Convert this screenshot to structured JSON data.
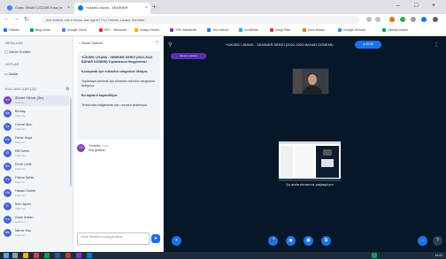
{
  "browser": {
    "tabs": [
      {
        "label": "Sınav SINAV ÇÖZÜM Kısa | ▸",
        "active": false
      },
      {
        "label": "Yüksek Lisans - SEMİNER",
        "active": true
      }
    ],
    "new_tab": "+",
    "url": "bbb.blikent.edu.tr/b/osz-nav-lgk-tr7/?c=Yüksek-Lisans-Seminer",
    "bookmarks": [
      "Fakülte",
      "Blog İçerik",
      "Google Çeviri",
      "KEY - Microsoft",
      "Dosya Görsel",
      "YÖK Akademik",
      "Yeni sekme",
      "ULAKBİM",
      "Dergi Park",
      "Ders Notları",
      "Google Scholar",
      "Okuma Listesi"
    ]
  },
  "userlist": {
    "messages_title": "MESAJLAR",
    "public_chat": "Genel Sohbet",
    "notes_title": "NOTLAR",
    "notes_item": "Notlar",
    "users_title": "KULLANICILAR (26)",
    "users": [
      {
        "initials": "Ah",
        "name": "Ahmet Yılmaz (Siz)",
        "role": "Sunucu"
      },
      {
        "initials": "Be",
        "name": "Berkay",
        "role": "Katılımcı"
      },
      {
        "initials": "Ce",
        "name": "Cemal Akın",
        "role": "Katılımcı"
      },
      {
        "initials": "De",
        "name": "Deniz Kaya",
        "role": "Katılımcı"
      },
      {
        "initials": "El",
        "name": "Elif Demir",
        "role": "Katılımcı"
      },
      {
        "initials": "Em",
        "name": "Emre Çelik",
        "role": "Katılımcı"
      },
      {
        "initials": "Fa",
        "name": "Fatma Şahin",
        "role": "Katılımcı"
      },
      {
        "initials": "Ha",
        "name": "Hakan Öztürk",
        "role": "Katılımcı"
      },
      {
        "initials": "İr",
        "name": "İrem Aydın",
        "role": "Katılımcı"
      },
      {
        "initials": "Ka",
        "name": "Kaan Arslan",
        "role": "Katılımcı"
      },
      {
        "initials": "Me",
        "name": "Merve Koç",
        "role": "Katılımcı"
      }
    ]
  },
  "chat": {
    "header": "Genel Sohbet",
    "close": "×",
    "welcome_title": "YÜKSEK LİSANS - SEMİNER DERSİ (2022-2023 BAHAR DÖNEMİ) Toplantısına Hoşgeldiniz!",
    "welcome_p1": "Konuşmak için mikrofon simgesine tıklayın.",
    "welcome_p2": "Toplantıya katılmak için ekranda mikrofon simgesine tıklayınız.",
    "welcome_p3": "Bu toplantı kaydediliyor",
    "welcome_p4": "Telefondan bağlanmak için: numara bekleniyor",
    "msg_initials": "Yö",
    "msg_name": "Yönetici",
    "msg_time": "14:02",
    "msg_text": "Hoş geldiniz.",
    "input_placeholder": "Genel Sohbet'e mesaj gönderin",
    "send": "➤"
  },
  "main": {
    "title": "YÜKSEK LİSANS - SEMİNER DERSİ (2022-2023 BAHAR DÖNEMİ)",
    "recording": "00:55",
    "tag": "Sunucu ekranı",
    "share_label": "Şu anda ekranınız paylaşılıyor",
    "controls": [
      "+",
      "🎤",
      "◉",
      "▣",
      "⧉"
    ],
    "right_controls": [
      "⋯",
      "?"
    ]
  },
  "taskbar": {
    "clock": "14:03"
  }
}
